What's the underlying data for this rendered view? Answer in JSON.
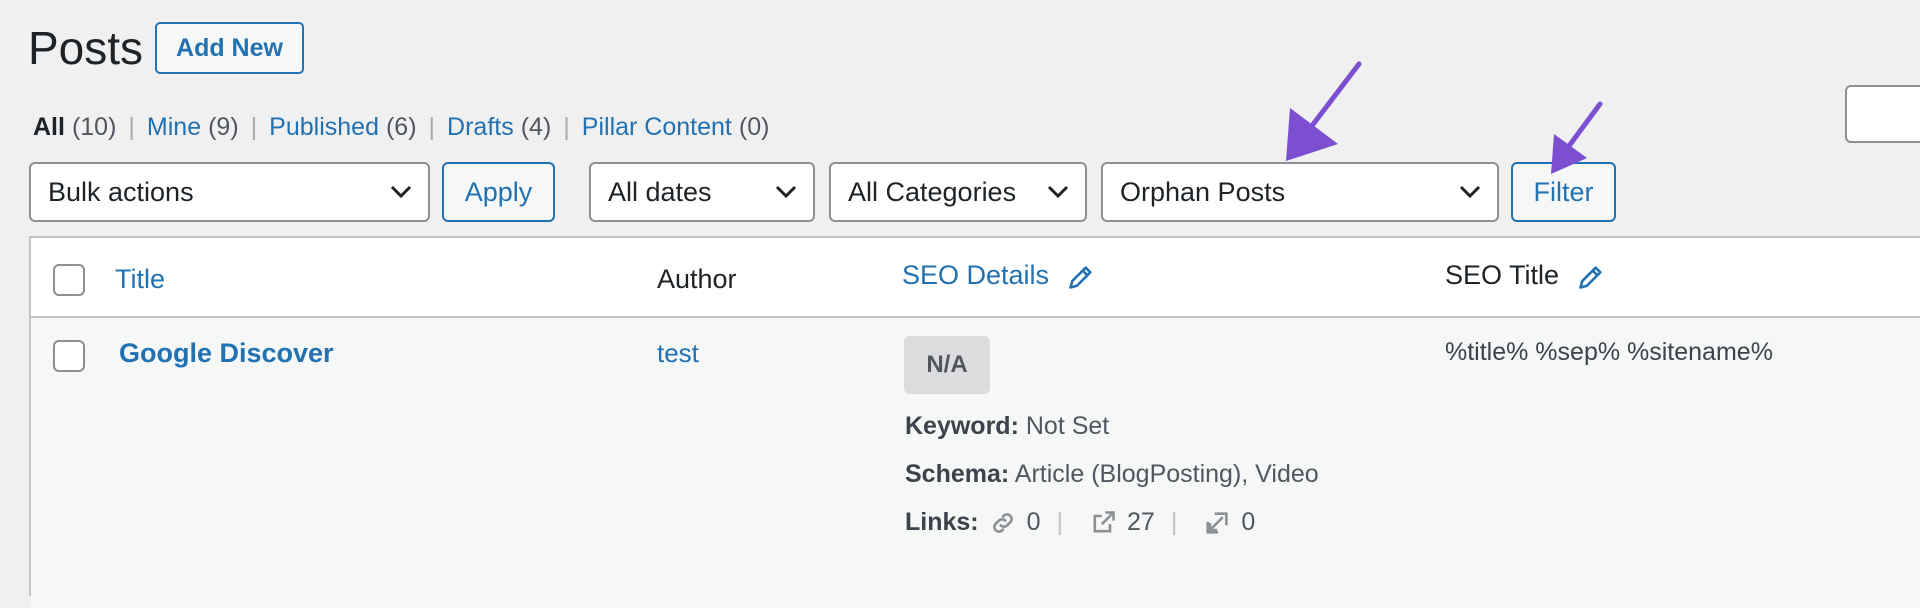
{
  "header": {
    "title": "Posts",
    "add_new_label": "Add New"
  },
  "views": [
    {
      "label": "All",
      "count": "(10)",
      "current": true
    },
    {
      "label": "Mine",
      "count": "(9)"
    },
    {
      "label": "Published",
      "count": "(6)"
    },
    {
      "label": "Drafts",
      "count": "(4)"
    },
    {
      "label": "Pillar Content",
      "count": "(0)"
    }
  ],
  "views_separator": "|",
  "filters": {
    "bulk_actions": "Bulk actions",
    "apply_label": "Apply",
    "dates": "All dates",
    "categories": "All Categories",
    "seo_filter": "Orphan Posts",
    "filter_label": "Filter"
  },
  "table": {
    "columns": {
      "title": "Title",
      "author": "Author",
      "seo_details": "SEO Details",
      "seo_title": "SEO Title"
    },
    "rows": [
      {
        "title": "Google Discover",
        "author": "test",
        "seo_score": "N/A",
        "keyword_label": "Keyword:",
        "keyword_value": "Not Set",
        "schema_label": "Schema:",
        "schema_value": "Article (BlogPosting), Video",
        "links_label": "Links:",
        "internal_links": "0",
        "external_links": "27",
        "incoming_links": "0",
        "seo_title": "%title% %sep% %sitename%"
      }
    ]
  },
  "colors": {
    "accent": "#2271b1",
    "annotation_arrow": "#7b4fd0"
  }
}
